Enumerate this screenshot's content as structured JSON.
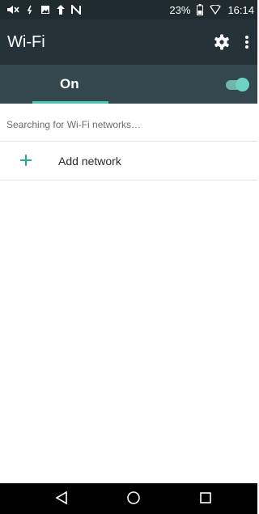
{
  "status_bar": {
    "left_icons": [
      "mute-icon",
      "nfc-icon",
      "image-icon",
      "upload-icon",
      "n-icon"
    ],
    "battery_percent": "23%",
    "right_icons": [
      "battery-icon",
      "wifi-signal-icon"
    ],
    "time": "16:14"
  },
  "app_bar": {
    "title": "Wi-Fi",
    "actions": [
      "settings-gear-icon",
      "more-options-icon"
    ]
  },
  "wifi_toggle": {
    "label": "On",
    "state": true,
    "accent": "#4fc3b3"
  },
  "status_message": "Searching for Wi-Fi networks…",
  "add_network": {
    "icon": "plus-icon",
    "label": "Add network"
  },
  "nav_bar": {
    "buttons": [
      "back-icon",
      "home-icon",
      "recents-icon"
    ]
  }
}
